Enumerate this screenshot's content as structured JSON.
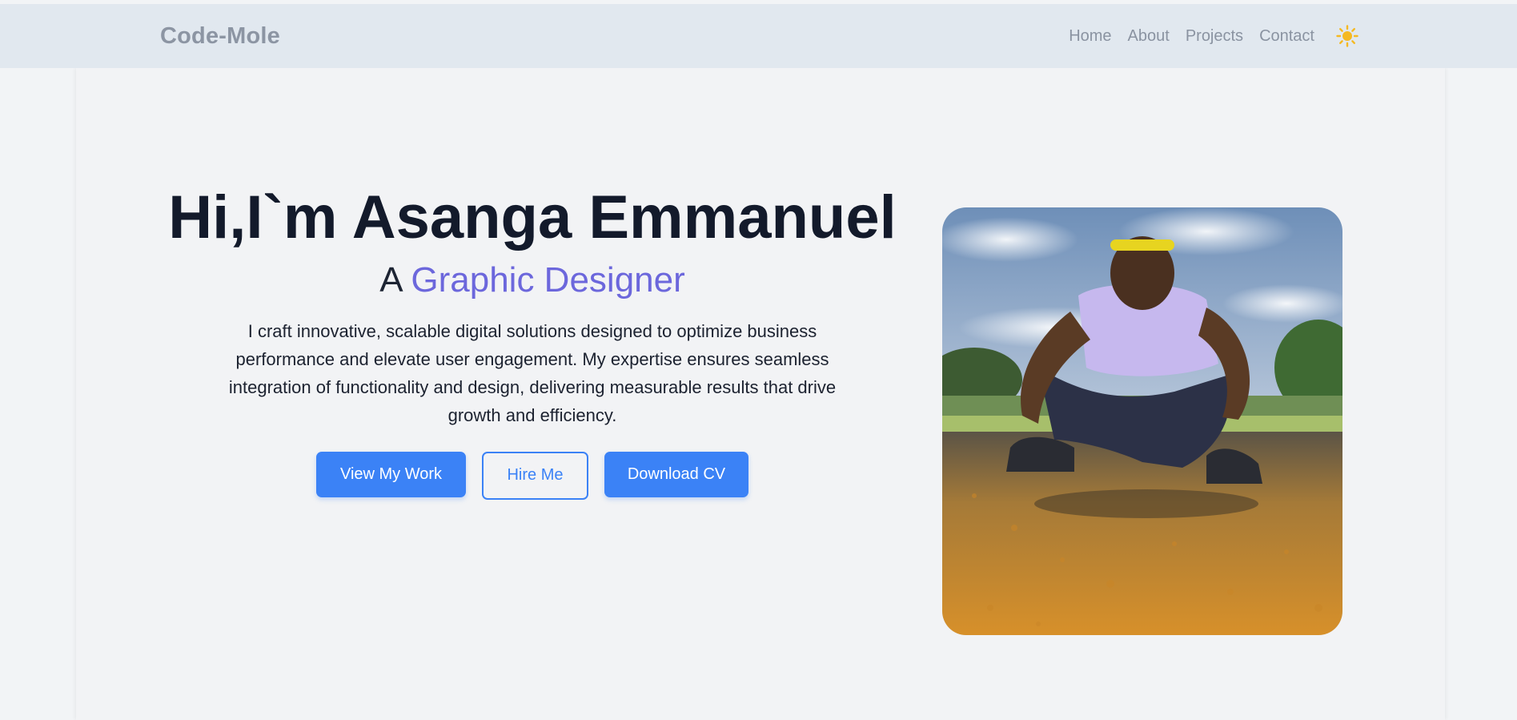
{
  "nav": {
    "brand": "Code-Mole",
    "links": [
      "Home",
      "About",
      "Projects",
      "Contact"
    ],
    "theme_icon": "sun-icon"
  },
  "hero": {
    "title": "Hi,I`m Asanga Emmanuel",
    "subtitle_prefix": "A",
    "subtitle_role": "Graphic Designer",
    "description": "I craft innovative, scalable digital solutions designed to optimize business performance and elevate user engagement. My expertise ensures seamless integration of functionality and design, delivering measurable results that drive growth and efficiency.",
    "buttons": {
      "view_work": "View My Work",
      "hire": "Hire Me",
      "download_cv": "Download CV"
    },
    "photo_icon": "profile-photo"
  },
  "colors": {
    "accent": "#3b82f6",
    "role_text": "#6c67dc",
    "nav_bg": "#e1e8ef",
    "sun": "#f5b921"
  }
}
